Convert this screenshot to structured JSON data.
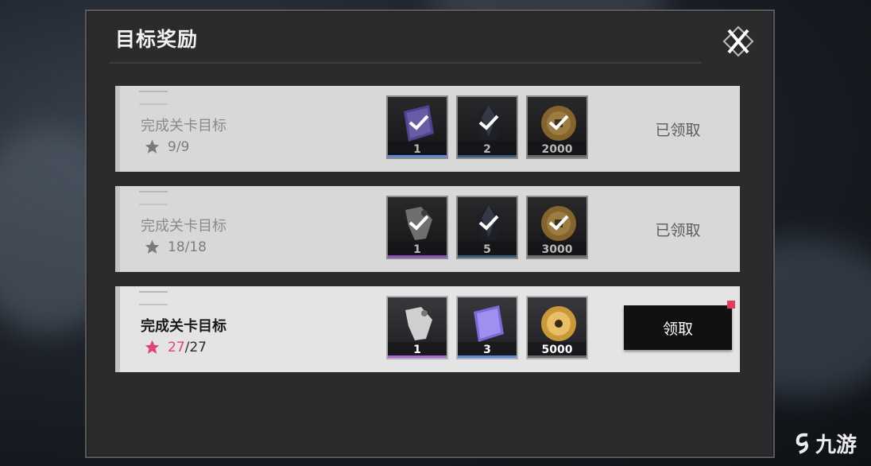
{
  "dialog": {
    "title": "目标奖励"
  },
  "rows": [
    {
      "name": "完成关卡目标",
      "progress_current": "9",
      "progress_total": "/9",
      "status": "已领取",
      "items": [
        {
          "icon": "purple-notebook-icon",
          "qty": "1",
          "rarity_color": "#5b8bd6"
        },
        {
          "icon": "dark-crystal-icon",
          "qty": "2",
          "rarity_color": "#3c5a7a"
        },
        {
          "icon": "gold-coin-icon",
          "qty": "2000",
          "rarity_color": "#6a6a6a"
        }
      ]
    },
    {
      "name": "完成关卡目标",
      "progress_current": "18",
      "progress_total": "/18",
      "status": "已领取",
      "items": [
        {
          "icon": "silver-tag-icon",
          "qty": "1",
          "rarity_color": "#8a4fb5"
        },
        {
          "icon": "dark-crystal-icon",
          "qty": "5",
          "rarity_color": "#3c5a7a"
        },
        {
          "icon": "gold-coin-icon",
          "qty": "3000",
          "rarity_color": "#6a6a6a"
        }
      ]
    },
    {
      "name": "完成关卡目标",
      "progress_current": "27",
      "progress_total": "/27",
      "button": "领取",
      "items": [
        {
          "icon": "silver-tag-icon",
          "qty": "1",
          "rarity_color": "#a866d6"
        },
        {
          "icon": "purple-notebook-icon",
          "qty": "3",
          "rarity_color": "#5b8bd6"
        },
        {
          "icon": "gold-coin-icon",
          "qty": "5000",
          "rarity_color": "#6a6a6a"
        }
      ]
    }
  ],
  "watermark": {
    "text": "九游"
  },
  "colors": {
    "accent_pink": "#e5407c",
    "notification_red": "#e23b5c"
  }
}
